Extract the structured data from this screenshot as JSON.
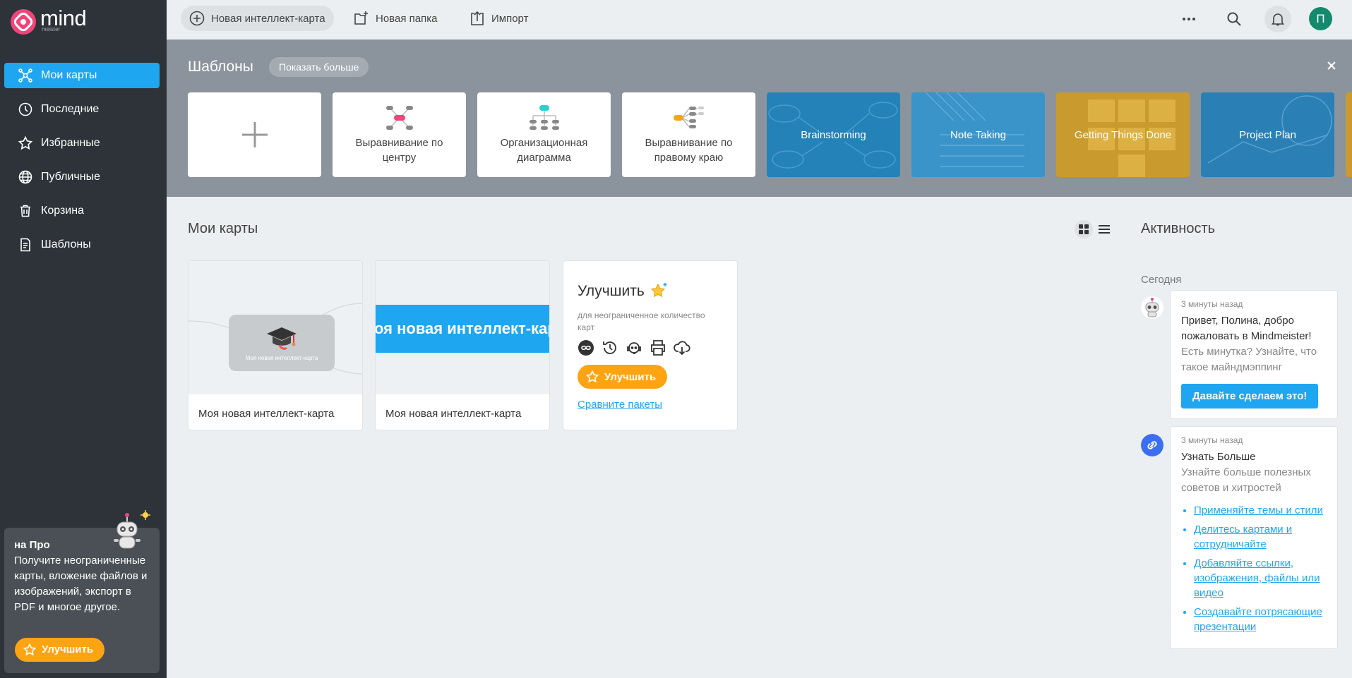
{
  "brand": {
    "name": "mind",
    "sub": "meister",
    "accent": "#1fa6f0",
    "promo_color": "#fea413",
    "logo_color": "#f0457a"
  },
  "sidebar": {
    "items": [
      {
        "label": "Мои карты",
        "icon": "mindmap-icon",
        "active": true
      },
      {
        "label": "Последние",
        "icon": "clock-icon"
      },
      {
        "label": "Избранные",
        "icon": "star-icon"
      },
      {
        "label": "Публичные",
        "icon": "globe-icon"
      },
      {
        "label": "Корзина",
        "icon": "trash-icon"
      },
      {
        "label": "Шаблоны",
        "icon": "template-icon"
      }
    ],
    "promo": {
      "title": "на Про",
      "text": "Получите неограниченные карты, вложение файлов и изображений, экспорт в PDF и многое другое.",
      "button": "Улучшить"
    }
  },
  "topbar": {
    "new_map": "Новая интеллект-карта",
    "new_folder": "Новая папка",
    "import": "Импорт",
    "avatar_initial": "П"
  },
  "templates": {
    "title": "Шаблоны",
    "show_more": "Показать больше",
    "items": [
      {
        "label": "",
        "kind": "blank"
      },
      {
        "label": "Выравнивание по центру",
        "kind": "center"
      },
      {
        "label": "Организационная диаграмма",
        "kind": "org"
      },
      {
        "label": "Выравнивание по правому краю",
        "kind": "right"
      },
      {
        "label": "Brainstorming",
        "kind": "image",
        "color": "#2482b8"
      },
      {
        "label": "Note Taking",
        "kind": "image",
        "color": "#3a94c9"
      },
      {
        "label": "Getting Things Done",
        "kind": "image",
        "color": "#c99b2e"
      },
      {
        "label": "Project Plan",
        "kind": "image",
        "color": "#2a7fb5"
      }
    ]
  },
  "my_maps": {
    "title": "Мои карты",
    "maps": [
      {
        "name": "Моя новая интеллект-карта",
        "thumb_text": "Моя новая интеллект-карта"
      },
      {
        "name": "Моя новая интеллект-карта",
        "thumb_text": "оя новая интеллект-кар"
      }
    ],
    "upgrade": {
      "title": "Улучшить",
      "subtitle": "для неограниченное количество карт",
      "button": "Улучшить",
      "link": "Сравните пакеты"
    }
  },
  "activity": {
    "title": "Активность",
    "date": "Сегодня",
    "items": [
      {
        "time": "3 минуты назад",
        "head": "Привет, Полина, добро пожаловать в Mindmeister!",
        "text": "Есть минутка? Узнайте, что такое майндмэппинг",
        "button": "Давайте сделаем это!"
      },
      {
        "time": "3 минуты назад",
        "head": "Узнать Больше",
        "text": "Узнайте больше полезных советов и хитростей",
        "links": [
          "Применяйте темы и стили",
          "Делитесь картами и сотрудничайте",
          "Добавляйте ссылки, изображения, файлы или видео",
          "Создавайте потрясающие презентации"
        ]
      }
    ]
  }
}
